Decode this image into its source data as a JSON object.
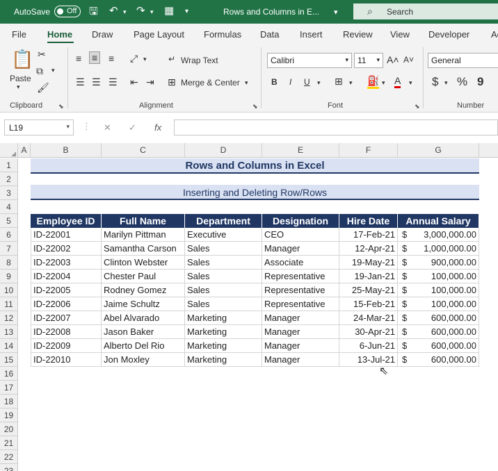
{
  "titlebar": {
    "autosave_label": "AutoSave",
    "autosave_state": "Off",
    "window_title": "Rows and Columns in E...",
    "search_placeholder": "Search"
  },
  "tabs": [
    "File",
    "Home",
    "Draw",
    "Page Layout",
    "Formulas",
    "Data",
    "Insert",
    "Review",
    "View",
    "Developer",
    "Ac"
  ],
  "active_tab": "Home",
  "ribbon": {
    "clipboard": {
      "paste": "Paste",
      "label": "Clipboard"
    },
    "alignment": {
      "wrap_text": "Wrap Text",
      "merge_center": "Merge & Center",
      "label": "Alignment"
    },
    "font": {
      "name": "Calibri",
      "size": "11",
      "label": "Font",
      "bold": "B",
      "italic": "I",
      "underline": "U"
    },
    "number": {
      "format": "General",
      "label": "Number",
      "currency": "$",
      "percent": "%",
      "comma": "9"
    }
  },
  "formula_bar": {
    "name_box": "L19",
    "fx": "fx",
    "value": ""
  },
  "columns": [
    "A",
    "B",
    "C",
    "D",
    "E",
    "F",
    "G"
  ],
  "rows": [
    "1",
    "2",
    "3",
    "4",
    "5",
    "6",
    "7",
    "8",
    "9",
    "10",
    "11",
    "12",
    "13",
    "14",
    "15",
    "16",
    "17",
    "18",
    "19",
    "20",
    "21",
    "22",
    "23"
  ],
  "sheet": {
    "title": "Rows and Columns in Excel",
    "subtitle": "Inserting and Deleting Row/Rows",
    "headers": [
      "Employee ID",
      "Full Name",
      "Department",
      "Designation",
      "Hire Date",
      "Annual Salary"
    ],
    "records": [
      [
        "ID-22001",
        "Marilyn Pittman",
        "Executive",
        "CEO",
        "17-Feb-21",
        "3,000,000.00"
      ],
      [
        "ID-22002",
        "Samantha Carson",
        "Sales",
        "Manager",
        "12-Apr-21",
        "1,000,000.00"
      ],
      [
        "ID-22003",
        "Clinton Webster",
        "Sales",
        "Associate",
        "19-May-21",
        "900,000.00"
      ],
      [
        "ID-22004",
        "Chester Paul",
        "Sales",
        "Representative",
        "19-Jan-21",
        "100,000.00"
      ],
      [
        "ID-22005",
        "Rodney Gomez",
        "Sales",
        "Representative",
        "25-May-21",
        "100,000.00"
      ],
      [
        "ID-22006",
        "Jaime Schultz",
        "Sales",
        "Representative",
        "15-Feb-21",
        "100,000.00"
      ],
      [
        "ID-22007",
        "Abel Alvarado",
        "Marketing",
        "Manager",
        "24-Mar-21",
        "600,000.00"
      ],
      [
        "ID-22008",
        "Jason Baker",
        "Marketing",
        "Manager",
        "30-Apr-21",
        "600,000.00"
      ],
      [
        "ID-22009",
        "Alberto Del Rio",
        "Marketing",
        "Manager",
        "6-Jun-21",
        "600,000.00"
      ],
      [
        "ID-22010",
        "Jon Moxley",
        "Marketing",
        "Manager",
        "13-Jul-21",
        "600,000.00"
      ]
    ],
    "currency_symbol": "$"
  },
  "colors": {
    "excel_green": "#217346",
    "header_navy": "#203764",
    "band_blue": "#d9e1f2"
  }
}
